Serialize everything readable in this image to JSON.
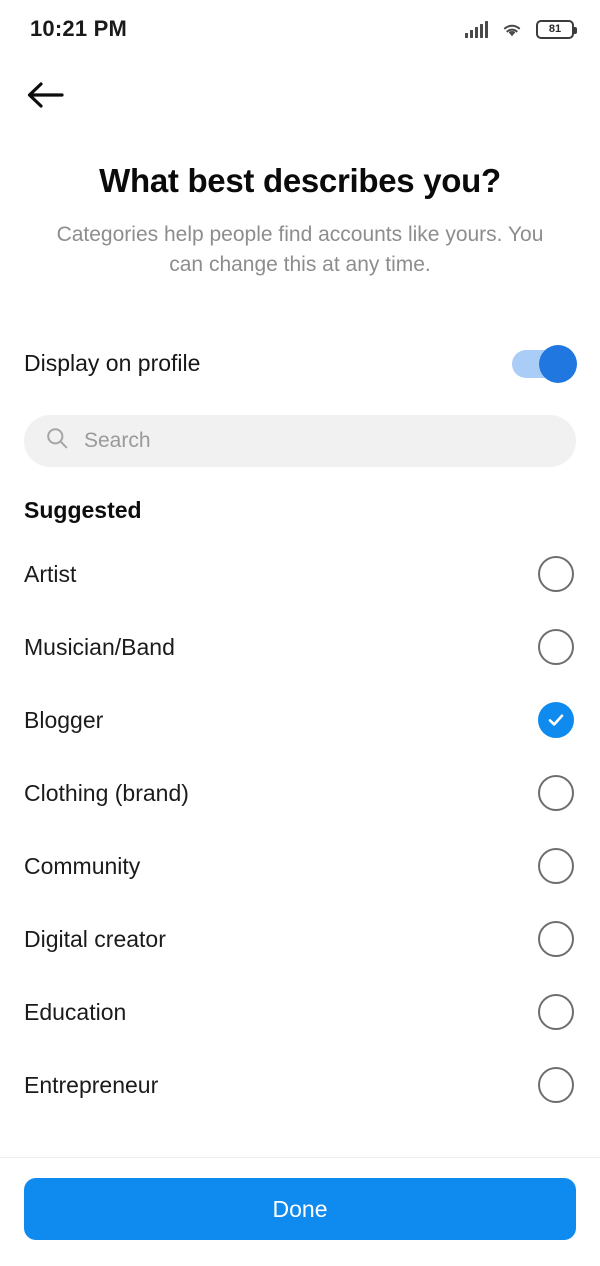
{
  "status_bar": {
    "time": "10:21 PM",
    "signal_icon": "signal-bars-icon",
    "wifi_icon": "wifi-icon",
    "battery_icon": "battery-icon",
    "battery_level": "81"
  },
  "nav": {
    "back_icon": "back-arrow-icon"
  },
  "header": {
    "title": "What best describes you?",
    "subtitle": "Categories help people find accounts like yours. You can change this at any time."
  },
  "display_toggle": {
    "label": "Display on profile",
    "enabled": true,
    "track_color": "#a9cdf7",
    "thumb_color": "#2077e0"
  },
  "search": {
    "placeholder": "Search",
    "value": "",
    "icon": "search-icon"
  },
  "categories": {
    "section_title": "Suggested",
    "items": [
      {
        "label": "Artist",
        "selected": false
      },
      {
        "label": "Musician/Band",
        "selected": false
      },
      {
        "label": "Blogger",
        "selected": true
      },
      {
        "label": "Clothing (brand)",
        "selected": false
      },
      {
        "label": "Community",
        "selected": false
      },
      {
        "label": "Digital creator",
        "selected": false
      },
      {
        "label": "Education",
        "selected": false
      },
      {
        "label": "Entrepreneur",
        "selected": false
      }
    ]
  },
  "footer": {
    "done_label": "Done",
    "accent_color": "#0f8bf0"
  }
}
